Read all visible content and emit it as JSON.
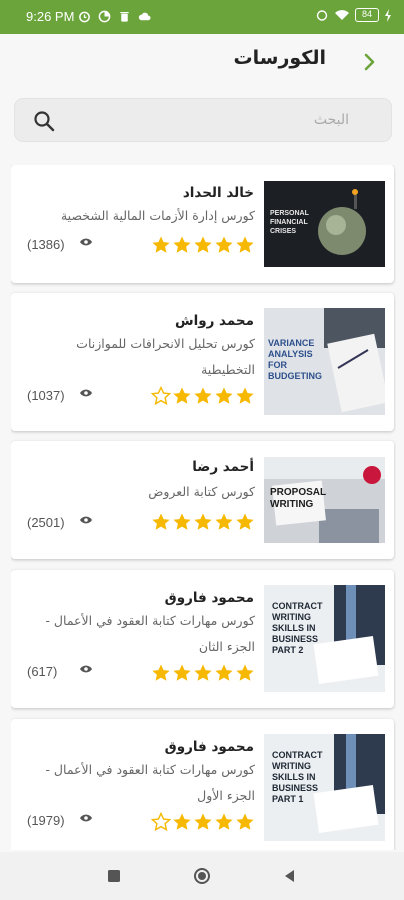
{
  "status_bar": {
    "time": "9:26 PM",
    "battery": "84"
  },
  "header": {
    "title": "الكورسات"
  },
  "search": {
    "placeholder": "البحث",
    "value": ""
  },
  "colors": {
    "accent": "#6aa43a",
    "star": "#f6b800"
  },
  "courses": [
    {
      "instructor": "خالد الحداد",
      "title": "كورس إدارة الأزمات المالية الشخصية",
      "rating": 5,
      "views": "(1386)",
      "thumbnail_text": "PERSONAL FINANCIAL CRISES"
    },
    {
      "instructor": "محمد رواش",
      "title": "كورس تحليل الانحرافات للموازنات التخطيطية",
      "rating": 4,
      "views": "(1037)",
      "thumbnail_text": "VARIANCE ANALYSIS FOR BUDGETING"
    },
    {
      "instructor": "أحمد رضا",
      "title": "كورس كتابة العروض",
      "rating": 5,
      "views": "(2501)",
      "thumbnail_text": "PROPOSAL WRITING"
    },
    {
      "instructor": "محمود فاروق",
      "title": "كورس مهارات كتابة العقود في الأعمال - الجزء الثان",
      "rating": 5,
      "views": "(617)",
      "thumbnail_text": "CONTRACT WRITING SKILLS IN BUSINESS PART 2"
    },
    {
      "instructor": "محمود فاروق",
      "title": "كورس مهارات كتابة العقود في الأعمال - الجزء الأول",
      "rating": 4,
      "views": "(1979)",
      "thumbnail_text": "CONTRACT WRITING SKILLS IN BUSINESS PART 1"
    }
  ],
  "nav_icons": [
    "recents-square-icon",
    "home-circle-icon",
    "back-triangle-icon"
  ]
}
